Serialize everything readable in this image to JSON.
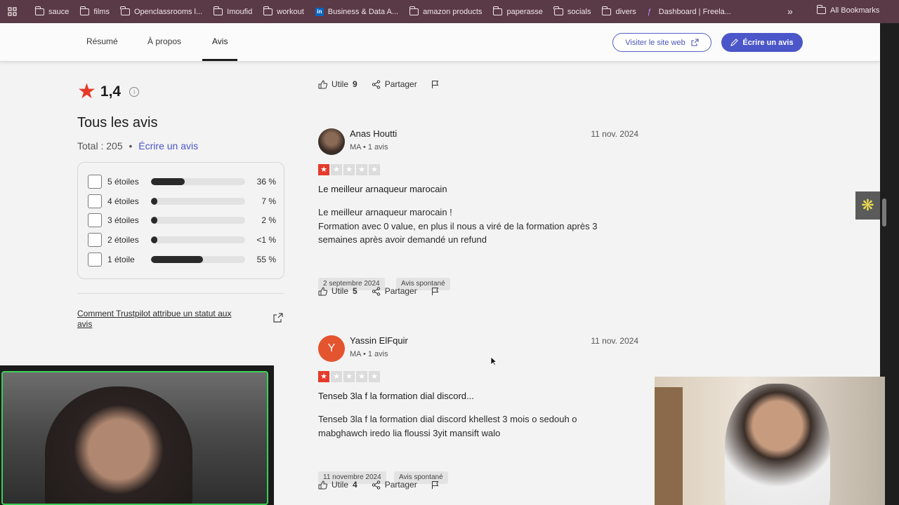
{
  "bookmarks": {
    "items": [
      {
        "label": "sauce",
        "icon": "folder-icon"
      },
      {
        "label": "films",
        "icon": "folder-icon"
      },
      {
        "label": "Openclassrooms l...",
        "icon": "folder-icon"
      },
      {
        "label": "Imoufid",
        "icon": "folder-icon"
      },
      {
        "label": "workout",
        "icon": "folder-icon"
      },
      {
        "label": "Business & Data A...",
        "icon": "linkedin-icon"
      },
      {
        "label": "amazon products",
        "icon": "folder-icon"
      },
      {
        "label": "paperasse",
        "icon": "folder-icon"
      },
      {
        "label": "socials",
        "icon": "folder-icon"
      },
      {
        "label": "divers",
        "icon": "folder-icon"
      },
      {
        "label": "Dashboard | Freela...",
        "icon": "dashboard-icon"
      }
    ],
    "more": "»",
    "all": "All Bookmarks"
  },
  "nav": {
    "tabs": [
      {
        "label": "Résumé"
      },
      {
        "label": "À propos"
      },
      {
        "label": "Avis"
      }
    ],
    "visit_button": "Visiter le site web",
    "write_button": "Écrire un avis"
  },
  "summary": {
    "rating": "1,4",
    "title": "Tous les avis",
    "total_label": "Total : 205",
    "separator": "•",
    "write_link": "Écrire un avis",
    "distribution": [
      {
        "label": "5 étoiles",
        "pct": "36 %",
        "value": 36
      },
      {
        "label": "4 étoiles",
        "pct": "7 %",
        "value": 7
      },
      {
        "label": "3 étoiles",
        "pct": "2 %",
        "value": 2
      },
      {
        "label": "2 étoiles",
        "pct": "<1 %",
        "value": 0.5
      },
      {
        "label": "1 étoile",
        "pct": "55 %",
        "value": 55
      }
    ],
    "trustpilot_link": "Comment Trustpilot attribue un statut aux avis"
  },
  "top_actions": {
    "useful_label": "Utile",
    "useful_count": "9",
    "share": "Partager"
  },
  "reviews": [
    {
      "name": "Anas Houtti",
      "meta": "MA • 1 avis",
      "date": "11 nov. 2024",
      "stars": 1,
      "title": "Le meilleur arnaqueur marocain",
      "body_lines": [
        "Le meilleur arnaqueur marocain !",
        "Formation avec 0 value, en plus il nous a viré de la formation après 3",
        "semaines après avoir demandé un refund"
      ],
      "tags": [
        "2 septembre 2024",
        "Avis spontané"
      ],
      "useful_label": "Utile",
      "useful_count": "5",
      "share": "Partager"
    },
    {
      "name": "Yassin ElFquir",
      "initial": "Y",
      "meta": "MA • 1 avis",
      "date": "11 nov. 2024",
      "stars": 1,
      "title": "Tenseb 3la f la formation dial discord...",
      "body_lines": [
        "Tenseb 3la f la formation dial discord khellest 3 mois o sedouh o",
        "mabghawch iredo lia floussi 3yit mansift walo"
      ],
      "tags": [
        "11 novembre 2024",
        "Avis spontané"
      ],
      "useful_label": "Utile",
      "useful_count": "4",
      "share": "Partager"
    }
  ],
  "colors": {
    "bookmark_bar": "#5a3a46",
    "accent": "#4b56c9",
    "star_red": "#e53a2b"
  }
}
